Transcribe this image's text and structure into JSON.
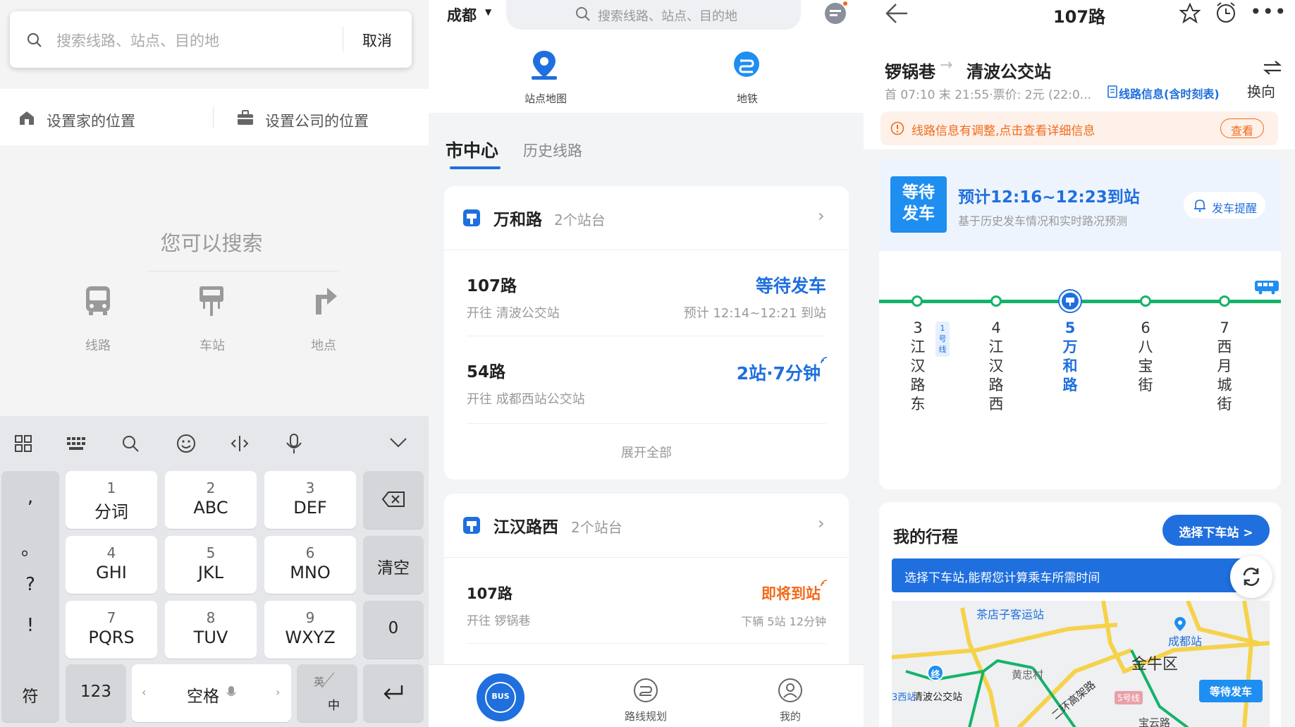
{
  "p1": {
    "search": {
      "placeholder": "搜索线路、站点、目的地",
      "cancel": "取消"
    },
    "shortcuts": {
      "home": "设置家的位置",
      "company": "设置公司的位置"
    },
    "hint": "您可以搜索",
    "types": [
      {
        "label": "线路",
        "icon": "bus-icon"
      },
      {
        "label": "车站",
        "icon": "bus-stop-icon"
      },
      {
        "label": "地点",
        "icon": "direction-icon"
      }
    ],
    "keyboard": {
      "side": [
        ",",
        "。",
        "?",
        "!"
      ],
      "keys": [
        {
          "n": "1",
          "l": "分词"
        },
        {
          "n": "2",
          "l": "ABC"
        },
        {
          "n": "3",
          "l": "DEF"
        },
        {
          "n": "4",
          "l": "GHI"
        },
        {
          "n": "5",
          "l": "JKL"
        },
        {
          "n": "6",
          "l": "MNO"
        },
        {
          "n": "7",
          "l": "PQRS"
        },
        {
          "n": "8",
          "l": "TUV"
        },
        {
          "n": "9",
          "l": "WXYZ"
        }
      ],
      "clear": "清空",
      "zero": "0",
      "symbol": "符",
      "num": "123",
      "space": "空格",
      "lang_en": "英",
      "lang_zh": "中"
    }
  },
  "p2": {
    "city": "成都",
    "search_placeholder": "搜索线路、站点、目的地",
    "quick": [
      {
        "label": "站点地图"
      },
      {
        "label": "地铁"
      }
    ],
    "tabs": [
      {
        "label": "市中心"
      },
      {
        "label": "历史线路"
      }
    ],
    "stations": [
      {
        "name": "万和路",
        "count": "2个站台",
        "routes": [
          {
            "route": "107路",
            "dest": "开往 清波公交站",
            "status": "等待发车",
            "detail": "预计 12:14~12:21 到站"
          },
          {
            "route": "54路",
            "dest": "开往 成都西站公交站",
            "status": "2站·7分钟",
            "detail": ""
          }
        ],
        "more": "展开全部"
      },
      {
        "name": "江汉路西",
        "count": "2个站台",
        "routes": [
          {
            "route": "107路",
            "dest": "开往 锣锅巷",
            "status": "即将到站",
            "detail": "下辆 5站 12分钟"
          }
        ]
      }
    ],
    "nav": [
      {
        "label": "BUS"
      },
      {
        "label": "路线规划"
      },
      {
        "label": "我的"
      }
    ]
  },
  "p3": {
    "title": "107路",
    "from": "锣锅巷",
    "to": "清波公交站",
    "meta": "首 07:10 末 21:55·票价: 2元 (22:0...",
    "info_link": "线路信息(含时刻表)",
    "swap": "换向",
    "notice": "线路信息有调整,点击查看详细信息",
    "notice_btn": "查看",
    "wait_badge": "等待\n发车",
    "eta": "预计12:16~12:23到站",
    "eta_sub": "基于历史发车情况和实时路况预测",
    "remind": "发车提醒",
    "stops": [
      {
        "num": "3",
        "name": "江\n汉\n路\n东",
        "tag": "1\n号\n线"
      },
      {
        "num": "4",
        "name": "江\n汉\n路\n西"
      },
      {
        "num": "5",
        "name": "万\n和\n路"
      },
      {
        "num": "6",
        "name": "八\n宝\n街"
      },
      {
        "num": "7",
        "name": "西\n月\n城\n街"
      }
    ],
    "trip_title": "我的行程",
    "choose_btn": "选择下车站 >",
    "choose_tip": "选择下车站,能帮您计算乘车所需时间",
    "map": {
      "labels": [
        "茶店子客运站",
        "成都站",
        "金牛区",
        "黄忠村",
        "清波公交站",
        "3西站",
        "二环高架路",
        "5号线",
        "宝云路"
      ],
      "marker_end": "终",
      "marker_wait": "等待发车"
    },
    "colors": {
      "accent": "#1f6fde",
      "route": "#14b36b",
      "orange": "#f26a1b",
      "notice_bg": "#fdf1e9"
    }
  }
}
